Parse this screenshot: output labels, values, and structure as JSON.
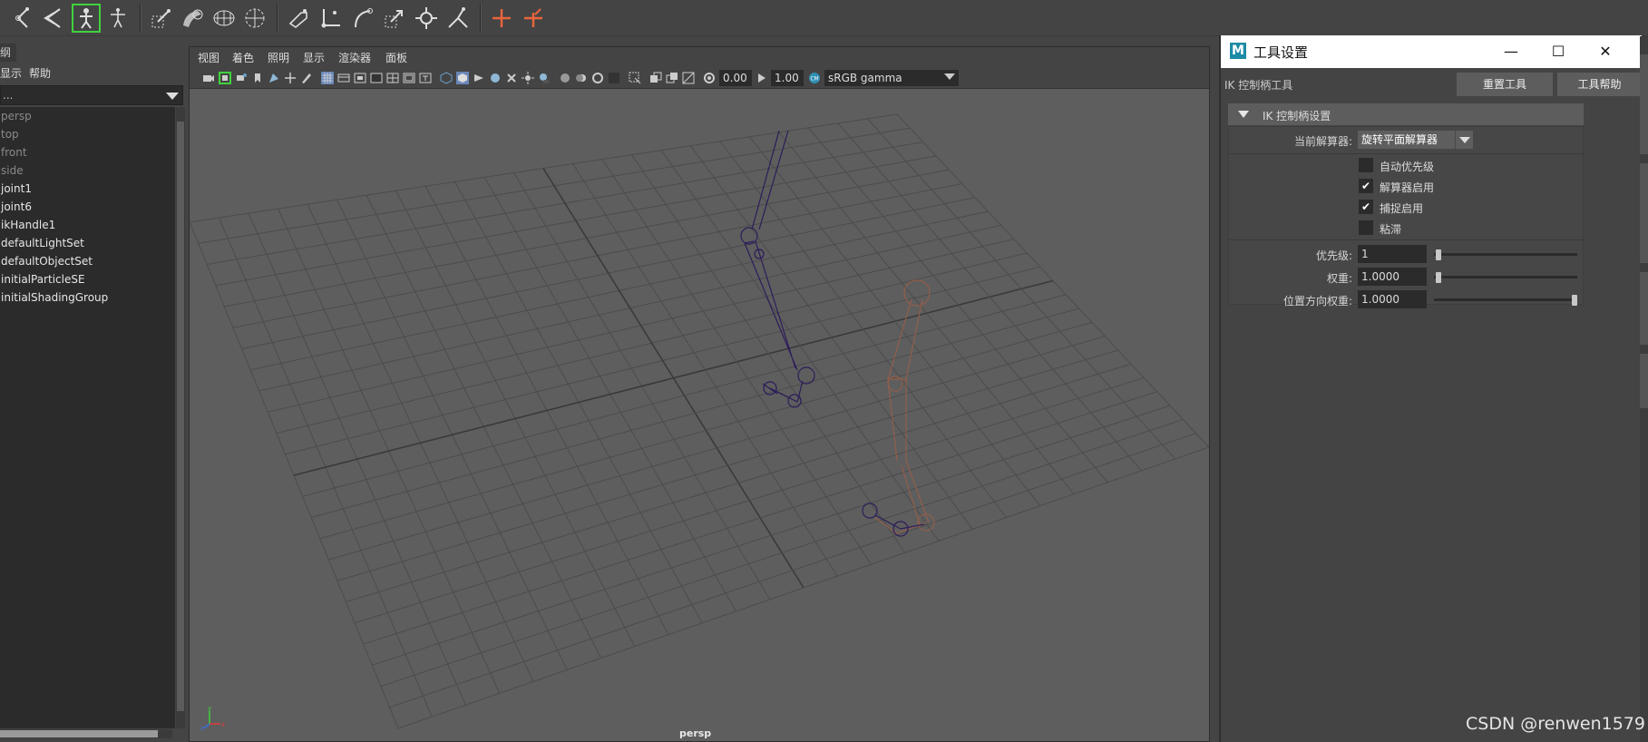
{
  "shelf": {
    "icons": [
      "joint-tool-icon",
      "ik-spline-icon",
      "humanik-icon",
      "skeleton-icon",
      "bind-skin-icon",
      "smooth-skin-icon",
      "lattice-icon",
      "cluster-icon",
      "paint-weights-icon",
      "joint-orient-icon",
      "bend-icon",
      "scale-icon",
      "connect-icon",
      "retarget-icon",
      "rig-plus-icon",
      "rig-edit-icon"
    ]
  },
  "outliner": {
    "tab_label": "纲",
    "menu": [
      "显示",
      "帮助"
    ],
    "filter_value": "...",
    "items": [
      {
        "label": "persp",
        "dim": true
      },
      {
        "label": "top",
        "dim": true
      },
      {
        "label": "front",
        "dim": true
      },
      {
        "label": "side",
        "dim": true
      },
      {
        "label": "joint1",
        "dim": false
      },
      {
        "label": "joint6",
        "dim": false
      },
      {
        "label": "ikHandle1",
        "dim": false
      },
      {
        "label": "defaultLightSet",
        "dim": false
      },
      {
        "label": "defaultObjectSet",
        "dim": false
      },
      {
        "label": "initialParticleSE",
        "dim": false
      },
      {
        "label": "initialShadingGroup",
        "dim": false
      }
    ]
  },
  "viewport": {
    "menu": [
      "视图",
      "着色",
      "照明",
      "显示",
      "渲染器",
      "面板"
    ],
    "exposure": "0.00",
    "gamma": "1.00",
    "colorspace": "sRGB gamma",
    "camera_label": "persp",
    "axis_labels": {
      "x": "x",
      "y": "y",
      "z": "z"
    }
  },
  "tool_settings": {
    "window_title": "工具设置",
    "tool_name": "IK 控制柄工具",
    "reset_button": "重置工具",
    "help_button": "工具帮助",
    "section_title": "IK 控制柄设置",
    "solver_label": "当前解算器:",
    "solver_value": "旋转平面解算器",
    "checkboxes": [
      {
        "label": "自动优先级",
        "checked": false
      },
      {
        "label": "解算器启用",
        "checked": true
      },
      {
        "label": "捕捉启用",
        "checked": true
      },
      {
        "label": "粘滞",
        "checked": false
      }
    ],
    "fields": [
      {
        "label": "优先级:",
        "value": "1",
        "slider": 0.0
      },
      {
        "label": "权重:",
        "value": "1.0000",
        "slider": 0.0
      },
      {
        "label": "位置方向权重:",
        "value": "1.0000",
        "slider": 1.0
      }
    ]
  },
  "watermark": "CSDN @renwen1579",
  "colors": {
    "active_joint": "#2a1a4a",
    "ghost_joint": "#8a5a45",
    "accent_green": "#3fd23f"
  }
}
